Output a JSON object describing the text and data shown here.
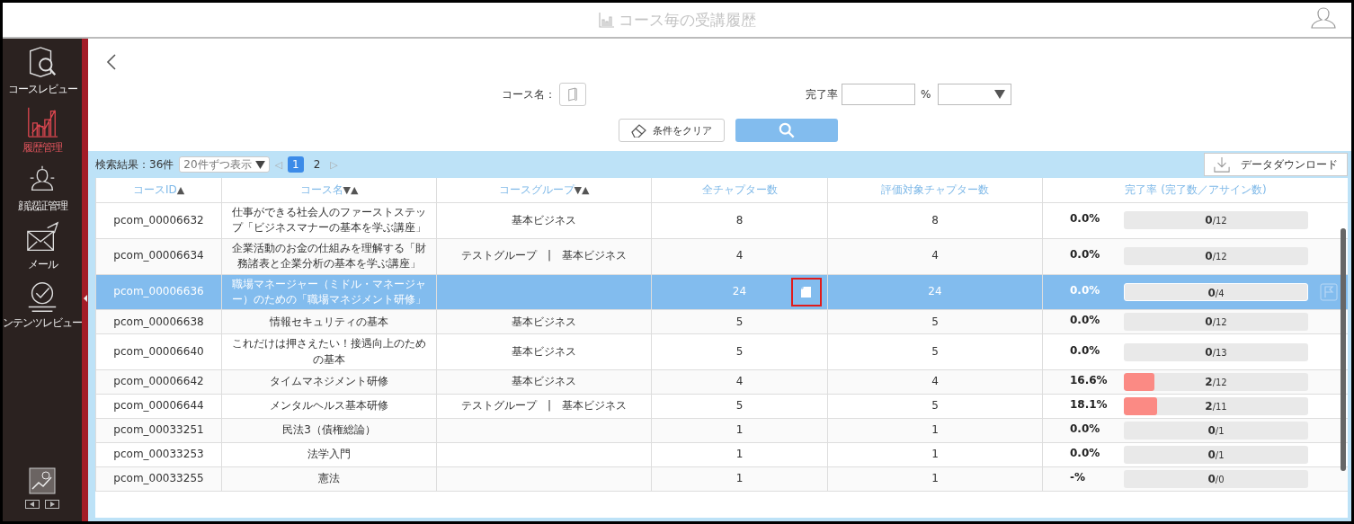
{
  "header": {
    "title": "コース毎の受講履歴"
  },
  "sidebar": {
    "items": [
      {
        "kind": "review",
        "label": "コースレビュー",
        "selected": false
      },
      {
        "kind": "history",
        "label": "履歴管理",
        "selected": true
      },
      {
        "kind": "face",
        "label": "顔認証管理",
        "selected": false
      },
      {
        "kind": "mail",
        "label": "メール",
        "selected": false
      },
      {
        "kind": "content",
        "label": "ンテンツレビュー",
        "selected": false
      }
    ]
  },
  "filters": {
    "course_name_label": "コース名：",
    "rate_label": "完了率",
    "rate_unit": "%",
    "clear_button": "条件をクリア"
  },
  "results": {
    "count": "検索結果：36件",
    "page_size": "20件ずつ表示",
    "prev": "◁",
    "next": "▷",
    "pages": [
      {
        "label": "1",
        "selected": true
      },
      {
        "label": "2",
        "selected": false
      }
    ],
    "download": "データダウンロード"
  },
  "table": {
    "columns": [
      {
        "label": "コースID",
        "sort": "▲"
      },
      {
        "label": "コース名",
        "sort": "▼▲"
      },
      {
        "label": "コースグループ",
        "sort": "▼▲"
      },
      {
        "label": "全チャプター数"
      },
      {
        "label": "評価対象チャプター数"
      },
      {
        "label": "完了率 (完了数／アサイン数)"
      }
    ],
    "rows": [
      {
        "id": "pcom_00006632",
        "name": "仕事ができる社会人のファーストステップ「ビジネスマナーの基本を学ぶ講座」",
        "group": "基本ビジネス",
        "chapters": "8",
        "eval": "8",
        "rate": "0.0%",
        "done": "0",
        "total": "/12",
        "selected": false
      },
      {
        "id": "pcom_00006634",
        "name": "企業活動のお金の仕組みを理解する「財務諸表と企業分析の基本を学ぶ講座」",
        "group": "テストグループ　|　基本ビジネス",
        "chapters": "4",
        "eval": "4",
        "rate": "0.0%",
        "done": "0",
        "total": "/12",
        "selected": false
      },
      {
        "id": "pcom_00006636",
        "name": "職場マネージャー（ミドル・マネージャー）のための「職場マネジメント研修」",
        "chapters": "24",
        "eval": "24",
        "rate": "0.0%",
        "done": "0",
        "total": "/4",
        "selected": true
      },
      {
        "id": "pcom_00006638",
        "name": "情報セキュリティの基本",
        "group": "基本ビジネス",
        "chapters": "5",
        "eval": "5",
        "rate": "0.0%",
        "done": "0",
        "total": "/12",
        "selected": false
      },
      {
        "id": "pcom_00006640",
        "name": "これだけは押さえたい！接遇向上のための基本",
        "group": "基本ビジネス",
        "chapters": "5",
        "eval": "5",
        "rate": "0.0%",
        "done": "0",
        "total": "/13",
        "selected": false
      },
      {
        "id": "pcom_00006642",
        "name": "タイムマネジメント研修",
        "group": "基本ビジネス",
        "chapters": "4",
        "eval": "4",
        "rate": "16.6%",
        "level": 0.166,
        "done": "2",
        "total": "/12",
        "selected": false
      },
      {
        "id": "pcom_00006644",
        "name": "メンタルヘルス基本研修",
        "group": "テストグループ　|　基本ビジネス",
        "chapters": "5",
        "eval": "5",
        "rate": "18.1%",
        "level": 0.181,
        "done": "2",
        "total": "/11",
        "selected": false
      },
      {
        "id": "pcom_00033251",
        "name": "民法3（債権総論）",
        "chapters": "1",
        "eval": "1",
        "rate": "0.0%",
        "done": "0",
        "total": "/1",
        "selected": false
      },
      {
        "id": "pcom_00033253",
        "name": "法学入門",
        "chapters": "1",
        "eval": "1",
        "rate": "0.0%",
        "done": "0",
        "total": "/1",
        "selected": false
      },
      {
        "id": "pcom_00033255",
        "name": "憲法",
        "chapters": "1",
        "eval": "1",
        "rate": "-%",
        "done": "0",
        "total": "/0",
        "selected": false
      }
    ]
  }
}
